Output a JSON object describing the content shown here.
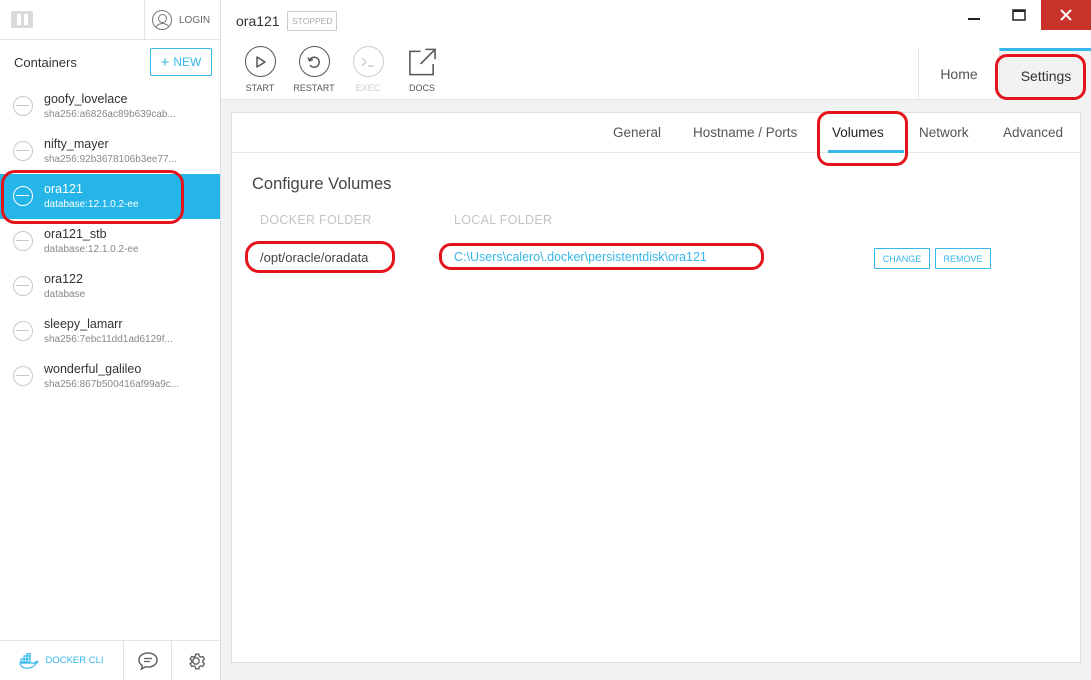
{
  "sidebar": {
    "login_label": "LOGIN",
    "containers_title": "Containers",
    "new_button": "NEW",
    "items": [
      {
        "name": "goofy_lovelace",
        "sub": "sha256:a6826ac89b639cab..."
      },
      {
        "name": "nifty_mayer",
        "sub": "sha256:92b3678106b3ee77..."
      },
      {
        "name": "ora121",
        "sub": "database:12.1.0.2-ee"
      },
      {
        "name": "ora121_stb",
        "sub": "database:12.1.0.2-ee"
      },
      {
        "name": "ora122",
        "sub": "database"
      },
      {
        "name": "sleepy_lamarr",
        "sub": "sha256:7ebc11dd1ad6129f..."
      },
      {
        "name": "wonderful_galileo",
        "sub": "sha256:867b500416af99a9c..."
      }
    ],
    "docker_cli": "DOCKER CLI"
  },
  "header": {
    "container_name": "ora121",
    "state": "STOPPED",
    "actions": {
      "start": "START",
      "restart": "RESTART",
      "exec": "EXEC",
      "docs": "DOCS"
    },
    "nav": {
      "home": "Home",
      "settings": "Settings"
    }
  },
  "settings": {
    "tabs": {
      "general": "General",
      "hostname": "Hostname / Ports",
      "volumes": "Volumes",
      "network": "Network",
      "advanced": "Advanced"
    },
    "section_title": "Configure Volumes",
    "columns": {
      "docker": "DOCKER FOLDER",
      "local": "LOCAL FOLDER"
    },
    "volume": {
      "docker_path": "/opt/oracle/oradata",
      "local_path": "C:\\Users\\calero\\.docker\\persistentdisk\\ora121",
      "change": "CHANGE",
      "remove": "REMOVE"
    }
  },
  "colors": {
    "accent": "#36b8ea",
    "selected": "#25b5e8",
    "annotation": "#e3141c",
    "close": "#c9312b"
  }
}
